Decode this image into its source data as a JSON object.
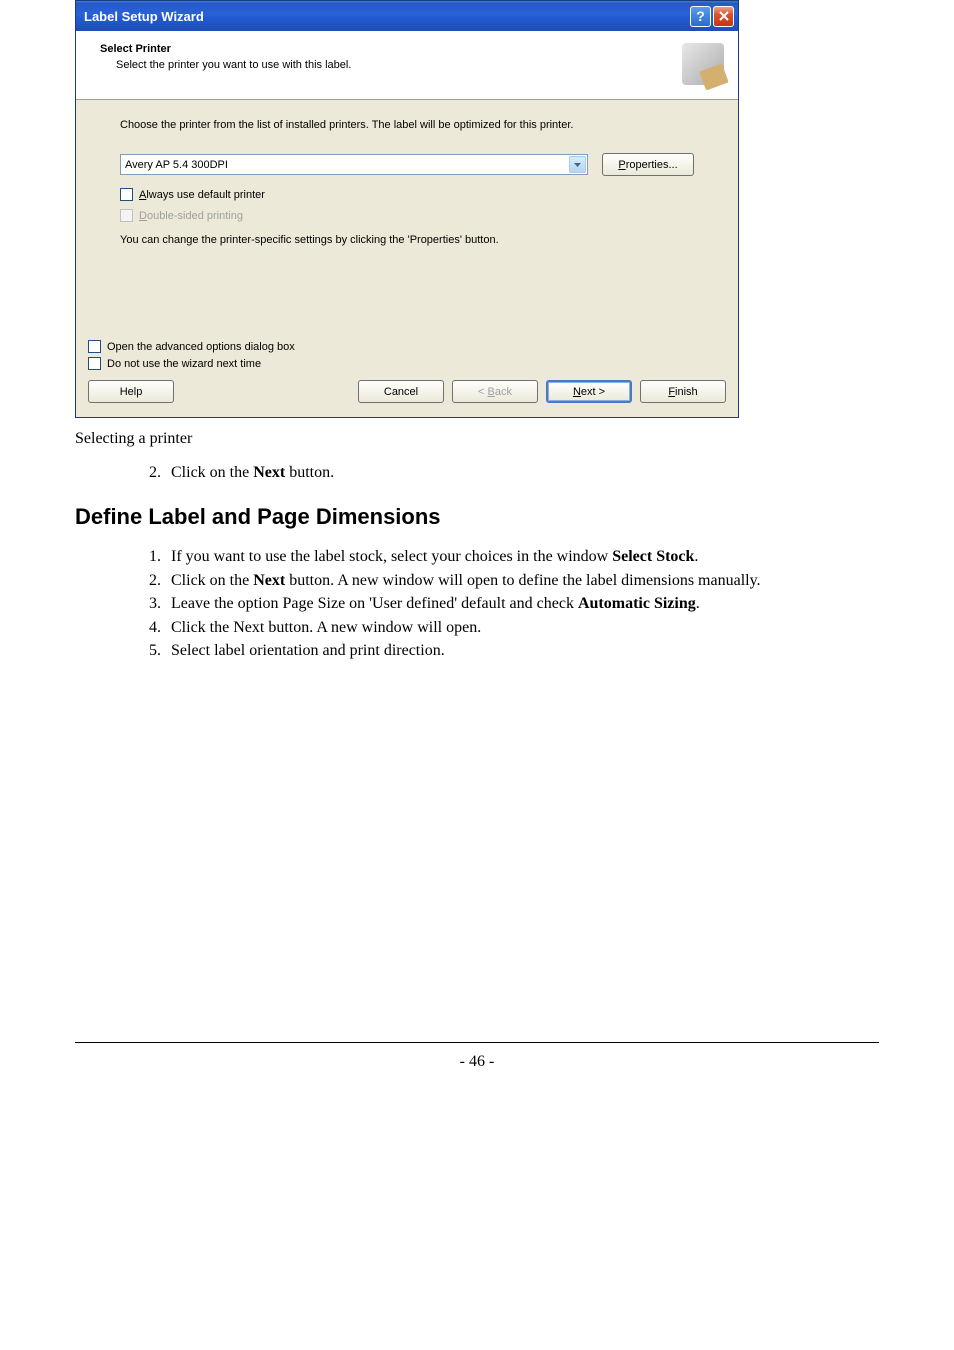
{
  "dialog": {
    "title": "Label Setup Wizard",
    "header": {
      "title": "Select Printer",
      "subtitle": "Select the printer you want to use with this label."
    },
    "content": {
      "instruction": "Choose the printer from the list of installed printers. The label will be optimized for this printer.",
      "printer_value": "Avery AP 5.4 300DPI",
      "properties_btn": "Properties...",
      "always_default": "lways use default printer",
      "always_default_prefix": "A",
      "double_sided": "ouble-sided printing",
      "double_sided_prefix": "D",
      "note": "You can change the printer-specific settings by clicking the 'Properties' button."
    },
    "footer": {
      "advanced": "Open the advanced options dialog box",
      "no_wizard": "Do not use the wizard next time",
      "help": "Help",
      "cancel": "Cancel",
      "back_prefix": "B",
      "back_rest": "ack",
      "next_prefix": "N",
      "next_rest": "ext >",
      "finish_prefix": "F",
      "finish_rest": "inish"
    }
  },
  "doc": {
    "caption": "Selecting a printer",
    "step2_pre": "Click on the ",
    "step2_bold": "Next",
    "step2_post": " button.",
    "section": "Define Label and Page Dimensions",
    "li1_pre": "If you want to use the label stock, select your choices in the window ",
    "li1_bold": "Select Stock",
    "li1_post": ".",
    "li2_pre": "Click on the ",
    "li2_bold": "Next",
    "li2_post": " button. A new window will open to define the label dimensions manually.",
    "li3_pre": "Leave the option Page Size on 'User defined' default and check ",
    "li3_bold": "Automatic Sizing",
    "li3_post": ".",
    "li4": "Click the Next button. A new window will open.",
    "li5": "Select label orientation and print direction.",
    "pagenum": "- 46 -"
  }
}
